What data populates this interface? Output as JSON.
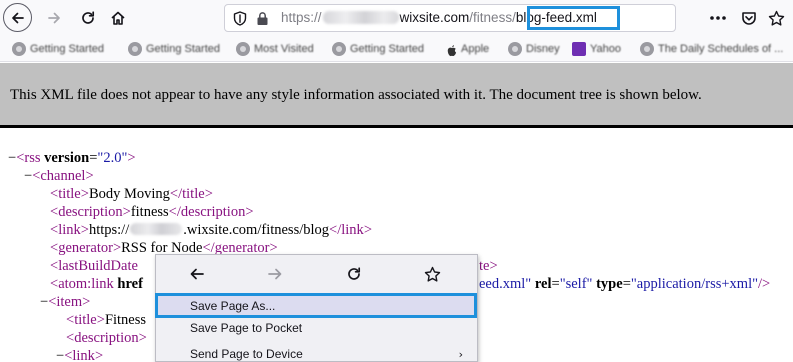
{
  "browser": {
    "url": {
      "protocol": "https://",
      "domain": "wixsite.com",
      "path_prefix": "/fitness/",
      "path_highlight": "blog-feed.xml"
    },
    "bookmarks": [
      {
        "label": "Getting Started",
        "icon": "globe-icon"
      },
      {
        "label": "Getting Started",
        "icon": "globe-icon"
      },
      {
        "label": "Most Visited",
        "icon": "gear-icon"
      },
      {
        "label": "Getting Started",
        "icon": "globe-icon"
      },
      {
        "label": "Apple",
        "icon": "apple-icon"
      },
      {
        "label": "Disney",
        "icon": "globe-icon"
      },
      {
        "label": "Yahoo",
        "icon": "yahoo-icon"
      },
      {
        "label": "The Daily Schedules of ...",
        "icon": "globe-icon"
      }
    ],
    "colors": {
      "highlight_border": "#1e90dc",
      "xml_tag": "#881280",
      "xml_attr_value": "#1a1aa6",
      "xml_banner_bg": "#c0c0c0"
    }
  },
  "xml_view": {
    "banner": "This XML file does not appear to have any style information associated with it. The document tree is shown below.",
    "fold_glyph": "−",
    "rss": {
      "tag": "rss",
      "attr": "version",
      "value": "\"2.0\""
    },
    "channel": "channel",
    "title": {
      "tag": "title",
      "text": "Body Moving"
    },
    "description": {
      "tag": "description",
      "text": "fitness"
    },
    "link": {
      "tag": "link",
      "prefix": "https://",
      "suffix": ".wixsite.com/fitness/blog"
    },
    "generator": {
      "tag": "generator",
      "text": "RSS for Node"
    },
    "last_build_date": {
      "tag": "lastBuildDate",
      "tail": "te>"
    },
    "atom_link": {
      "tag": "atom:link",
      "attr_href": "href",
      "tail": "eed.xml\"",
      "rel_attr": "rel",
      "rel_value": "\"self\"",
      "type_attr": "type",
      "type_value": "\"application/rss+xml\"",
      "close": "/>"
    },
    "item": "item",
    "item_title": {
      "tag": "title",
      "text": "Fitness"
    },
    "item_description": {
      "tag": "description"
    },
    "item_link": {
      "tag": "link"
    }
  },
  "context_menu": {
    "items": [
      {
        "label": "Save Page As...",
        "highlighted": true
      },
      {
        "label": "Save Page to Pocket"
      },
      {
        "label": "Send Page to Device",
        "submenu_arrow": "›"
      }
    ]
  }
}
